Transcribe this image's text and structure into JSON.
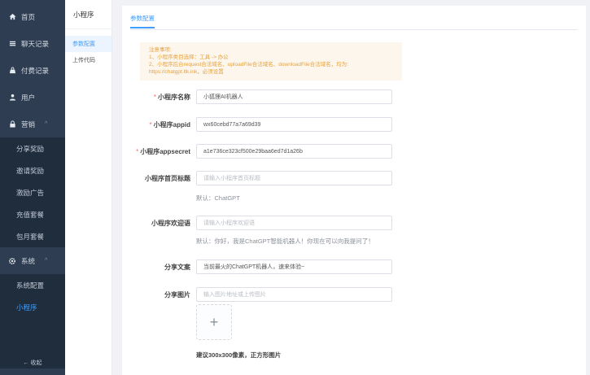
{
  "sidebar": {
    "items": [
      {
        "label": "首页",
        "icon": "home-icon"
      },
      {
        "label": "聊天记录",
        "icon": "list-icon"
      },
      {
        "label": "付费记录",
        "icon": "bag-icon"
      },
      {
        "label": "用户",
        "icon": "user-icon"
      },
      {
        "label": "营销",
        "icon": "lock-icon"
      }
    ],
    "marketing_sub": [
      "分享奖励",
      "邀请奖励",
      "激励广告",
      "充值套餐",
      "包月套餐"
    ],
    "system": {
      "label": "系统",
      "icon": "gear-icon"
    },
    "system_sub": [
      "系统配置",
      "小程序"
    ],
    "collapse_label": "← 收起"
  },
  "panel2": {
    "title": "小程序",
    "items": [
      "参数配置",
      "上传代码"
    ]
  },
  "tabs": [
    "参数配置"
  ],
  "notice": {
    "title": "注意事项:",
    "line1": "1、小程序类目选择：工具 -> 办公",
    "line2": "2、小程序后台request合法域名、uploadFile合法域名、downloadFile合法域名，均为:",
    "line3": "https://chatgpt.ltk.ink，必须设置"
  },
  "form": {
    "name_label": "小程序名称",
    "name_value": "小狐狸AI机器人",
    "appid_label": "小程序appid",
    "appid_value": "wx60cebd77a7a69d39",
    "secret_label": "小程序appsecret",
    "secret_value": "a1e736ce323cf500e29baa6ed7d1a26b",
    "home_title_label": "小程序首页标题",
    "home_title_placeholder": "请输入小程序首页标题",
    "home_title_hint": "默认：ChatGPT",
    "welcome_label": "小程序欢迎语",
    "welcome_placeholder": "请输入小程序欢迎语",
    "welcome_hint": "默认：你好，我是ChatGPT智能机器人！你现在可以向我提问了！",
    "share_text_label": "分享文案",
    "share_text_value": "当前最火的ChatGPT机器人，速来体验~",
    "share_image_label": "分享图片",
    "share_image_placeholder": "输入图片地址或上传图片",
    "upload_plus": "+",
    "size_hint": "建议300x300像素，正方形图片"
  },
  "colors": {
    "accent": "#409eff",
    "sidebar": "#2e3d52",
    "required": "#f56c6c",
    "notice_bg": "#fdf6ec",
    "notice_text": "#e6a23c"
  }
}
